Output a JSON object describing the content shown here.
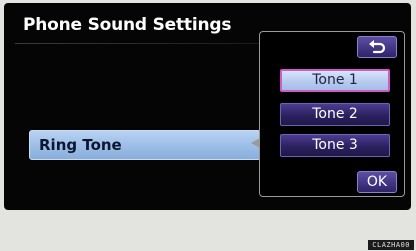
{
  "screen": {
    "title": "Phone Sound Settings"
  },
  "settings_row": {
    "label": "Ring Tone"
  },
  "popup": {
    "back_icon": "return-arrow-icon",
    "tones": [
      {
        "label": "Tone 1",
        "selected": true
      },
      {
        "label": "Tone 2",
        "selected": false
      },
      {
        "label": "Tone 3",
        "selected": false
      }
    ],
    "ok_label": "OK"
  },
  "image_code": "CLAZHA00",
  "colors": {
    "background": "#050506",
    "selected_border": "#d05ac8",
    "button_purple": "#2c215f",
    "row_highlight": "#9dbfe8"
  }
}
